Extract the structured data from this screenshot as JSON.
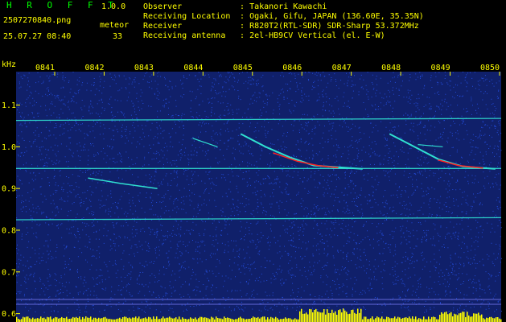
{
  "header": {
    "app_title": "H R O F F T",
    "version": "1.0.0",
    "filename": "2507270840.png",
    "datetime": "25.07.27 08:40",
    "meteor_label": "meteor",
    "meteor_count": "33",
    "info": [
      {
        "key": "Observer",
        "sep": ":",
        "value": "Takanori Kawachi"
      },
      {
        "key": "Receiving Location",
        "sep": ":",
        "value": "Ogaki, Gifu, JAPAN (136.60E, 35.35N)"
      },
      {
        "key": "Receiver",
        "sep": ":",
        "value": "R820T2(RTL-SDR) SDR-Sharp 53.372MHz"
      },
      {
        "key": "Receiving antenna",
        "sep": ":",
        "value": "2el-HB9CV Vertical (el. E-W)"
      }
    ]
  },
  "spectrogram": {
    "y_unit": "kHz",
    "time_ticks": [
      "0841",
      "0842",
      "0843",
      "0844",
      "0845",
      "0846",
      "0847",
      "0848",
      "0849",
      "0850"
    ],
    "freq_ticks": [
      "1.1",
      "1.0",
      "0.9",
      "0.8",
      "0.7",
      "0.6"
    ],
    "ylim": [
      0.58,
      1.18
    ],
    "colors": {
      "background": "#10206a",
      "tick": "#ffff00",
      "noise": "#2a5aff",
      "trace": "#30e0d0",
      "hot": "#ff2020",
      "level": "#ffff00"
    }
  }
}
